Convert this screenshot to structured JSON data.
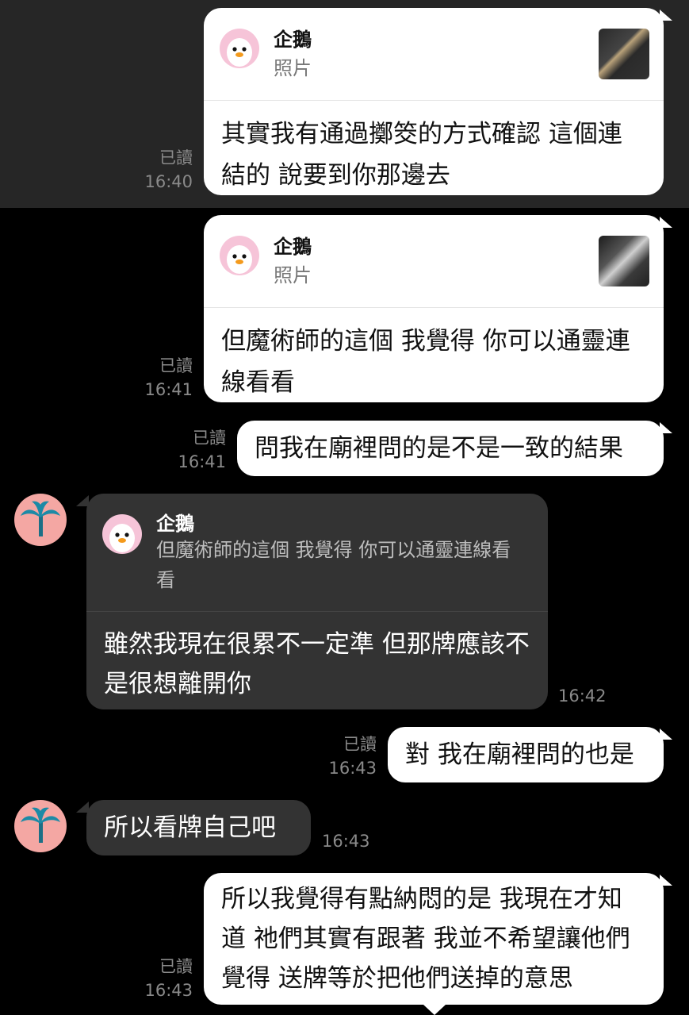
{
  "messages": [
    {
      "reply": {
        "name": "企鵝",
        "type": "照片"
      },
      "text": "其實我有通過擲筊的方式確認 這個連結的 說要到你那邊去",
      "read": "已讀",
      "time": "16:40"
    },
    {
      "reply": {
        "name": "企鵝",
        "type": "照片"
      },
      "text": "但魔術師的這個 我覺得 你可以通靈連線看看",
      "read": "已讀",
      "time": "16:41"
    },
    {
      "text": "問我在廟裡問的是不是一致的結果",
      "read": "已讀",
      "time": "16:41"
    },
    {
      "reply": {
        "name": "企鵝",
        "quote": "但魔術師的這個 我覺得 你可以通靈連線看看"
      },
      "text": "雖然我現在很累不一定準 但那牌應該不是很想離開你",
      "time": "16:42"
    },
    {
      "text": "對 我在廟裡問的也是",
      "read": "已讀",
      "time": "16:43"
    },
    {
      "text": "所以看牌自己吧",
      "time": "16:43"
    },
    {
      "text": "所以我覺得有點納悶的是 我現在才知道 祂們其實有跟著 我並不希望讓他們覺得 送牌等於把他們送掉的意思",
      "read": "已讀",
      "time": "16:43"
    }
  ],
  "icons": {
    "contact_avatar": "palm-tree-icon",
    "reply_avatar": "penguin-icon"
  },
  "colors": {
    "outgoing": "#ffffff",
    "incoming": "#333333",
    "background": "#000000",
    "meta": "#8a8a8a"
  }
}
